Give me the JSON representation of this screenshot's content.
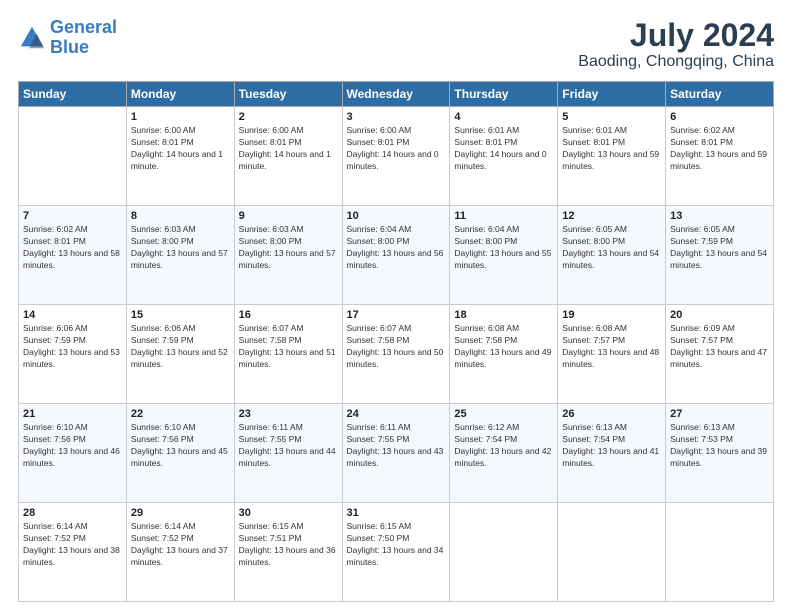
{
  "logo": {
    "line1": "General",
    "line2": "Blue"
  },
  "title": "July 2024",
  "subtitle": "Baoding, Chongqing, China",
  "headers": [
    "Sunday",
    "Monday",
    "Tuesday",
    "Wednesday",
    "Thursday",
    "Friday",
    "Saturday"
  ],
  "weeks": [
    [
      {
        "day": "",
        "sunrise": "",
        "sunset": "",
        "daylight": ""
      },
      {
        "day": "1",
        "sunrise": "Sunrise: 6:00 AM",
        "sunset": "Sunset: 8:01 PM",
        "daylight": "Daylight: 14 hours and 1 minute."
      },
      {
        "day": "2",
        "sunrise": "Sunrise: 6:00 AM",
        "sunset": "Sunset: 8:01 PM",
        "daylight": "Daylight: 14 hours and 1 minute."
      },
      {
        "day": "3",
        "sunrise": "Sunrise: 6:00 AM",
        "sunset": "Sunset: 8:01 PM",
        "daylight": "Daylight: 14 hours and 0 minutes."
      },
      {
        "day": "4",
        "sunrise": "Sunrise: 6:01 AM",
        "sunset": "Sunset: 8:01 PM",
        "daylight": "Daylight: 14 hours and 0 minutes."
      },
      {
        "day": "5",
        "sunrise": "Sunrise: 6:01 AM",
        "sunset": "Sunset: 8:01 PM",
        "daylight": "Daylight: 13 hours and 59 minutes."
      },
      {
        "day": "6",
        "sunrise": "Sunrise: 6:02 AM",
        "sunset": "Sunset: 8:01 PM",
        "daylight": "Daylight: 13 hours and 59 minutes."
      }
    ],
    [
      {
        "day": "7",
        "sunrise": "Sunrise: 6:02 AM",
        "sunset": "Sunset: 8:01 PM",
        "daylight": "Daylight: 13 hours and 58 minutes."
      },
      {
        "day": "8",
        "sunrise": "Sunrise: 6:03 AM",
        "sunset": "Sunset: 8:00 PM",
        "daylight": "Daylight: 13 hours and 57 minutes."
      },
      {
        "day": "9",
        "sunrise": "Sunrise: 6:03 AM",
        "sunset": "Sunset: 8:00 PM",
        "daylight": "Daylight: 13 hours and 57 minutes."
      },
      {
        "day": "10",
        "sunrise": "Sunrise: 6:04 AM",
        "sunset": "Sunset: 8:00 PM",
        "daylight": "Daylight: 13 hours and 56 minutes."
      },
      {
        "day": "11",
        "sunrise": "Sunrise: 6:04 AM",
        "sunset": "Sunset: 8:00 PM",
        "daylight": "Daylight: 13 hours and 55 minutes."
      },
      {
        "day": "12",
        "sunrise": "Sunrise: 6:05 AM",
        "sunset": "Sunset: 8:00 PM",
        "daylight": "Daylight: 13 hours and 54 minutes."
      },
      {
        "day": "13",
        "sunrise": "Sunrise: 6:05 AM",
        "sunset": "Sunset: 7:59 PM",
        "daylight": "Daylight: 13 hours and 54 minutes."
      }
    ],
    [
      {
        "day": "14",
        "sunrise": "Sunrise: 6:06 AM",
        "sunset": "Sunset: 7:59 PM",
        "daylight": "Daylight: 13 hours and 53 minutes."
      },
      {
        "day": "15",
        "sunrise": "Sunrise: 6:06 AM",
        "sunset": "Sunset: 7:59 PM",
        "daylight": "Daylight: 13 hours and 52 minutes."
      },
      {
        "day": "16",
        "sunrise": "Sunrise: 6:07 AM",
        "sunset": "Sunset: 7:58 PM",
        "daylight": "Daylight: 13 hours and 51 minutes."
      },
      {
        "day": "17",
        "sunrise": "Sunrise: 6:07 AM",
        "sunset": "Sunset: 7:58 PM",
        "daylight": "Daylight: 13 hours and 50 minutes."
      },
      {
        "day": "18",
        "sunrise": "Sunrise: 6:08 AM",
        "sunset": "Sunset: 7:58 PM",
        "daylight": "Daylight: 13 hours and 49 minutes."
      },
      {
        "day": "19",
        "sunrise": "Sunrise: 6:08 AM",
        "sunset": "Sunset: 7:57 PM",
        "daylight": "Daylight: 13 hours and 48 minutes."
      },
      {
        "day": "20",
        "sunrise": "Sunrise: 6:09 AM",
        "sunset": "Sunset: 7:57 PM",
        "daylight": "Daylight: 13 hours and 47 minutes."
      }
    ],
    [
      {
        "day": "21",
        "sunrise": "Sunrise: 6:10 AM",
        "sunset": "Sunset: 7:56 PM",
        "daylight": "Daylight: 13 hours and 46 minutes."
      },
      {
        "day": "22",
        "sunrise": "Sunrise: 6:10 AM",
        "sunset": "Sunset: 7:56 PM",
        "daylight": "Daylight: 13 hours and 45 minutes."
      },
      {
        "day": "23",
        "sunrise": "Sunrise: 6:11 AM",
        "sunset": "Sunset: 7:55 PM",
        "daylight": "Daylight: 13 hours and 44 minutes."
      },
      {
        "day": "24",
        "sunrise": "Sunrise: 6:11 AM",
        "sunset": "Sunset: 7:55 PM",
        "daylight": "Daylight: 13 hours and 43 minutes."
      },
      {
        "day": "25",
        "sunrise": "Sunrise: 6:12 AM",
        "sunset": "Sunset: 7:54 PM",
        "daylight": "Daylight: 13 hours and 42 minutes."
      },
      {
        "day": "26",
        "sunrise": "Sunrise: 6:13 AM",
        "sunset": "Sunset: 7:54 PM",
        "daylight": "Daylight: 13 hours and 41 minutes."
      },
      {
        "day": "27",
        "sunrise": "Sunrise: 6:13 AM",
        "sunset": "Sunset: 7:53 PM",
        "daylight": "Daylight: 13 hours and 39 minutes."
      }
    ],
    [
      {
        "day": "28",
        "sunrise": "Sunrise: 6:14 AM",
        "sunset": "Sunset: 7:52 PM",
        "daylight": "Daylight: 13 hours and 38 minutes."
      },
      {
        "day": "29",
        "sunrise": "Sunrise: 6:14 AM",
        "sunset": "Sunset: 7:52 PM",
        "daylight": "Daylight: 13 hours and 37 minutes."
      },
      {
        "day": "30",
        "sunrise": "Sunrise: 6:15 AM",
        "sunset": "Sunset: 7:51 PM",
        "daylight": "Daylight: 13 hours and 36 minutes."
      },
      {
        "day": "31",
        "sunrise": "Sunrise: 6:15 AM",
        "sunset": "Sunset: 7:50 PM",
        "daylight": "Daylight: 13 hours and 34 minutes."
      },
      {
        "day": "",
        "sunrise": "",
        "sunset": "",
        "daylight": ""
      },
      {
        "day": "",
        "sunrise": "",
        "sunset": "",
        "daylight": ""
      },
      {
        "day": "",
        "sunrise": "",
        "sunset": "",
        "daylight": ""
      }
    ]
  ]
}
